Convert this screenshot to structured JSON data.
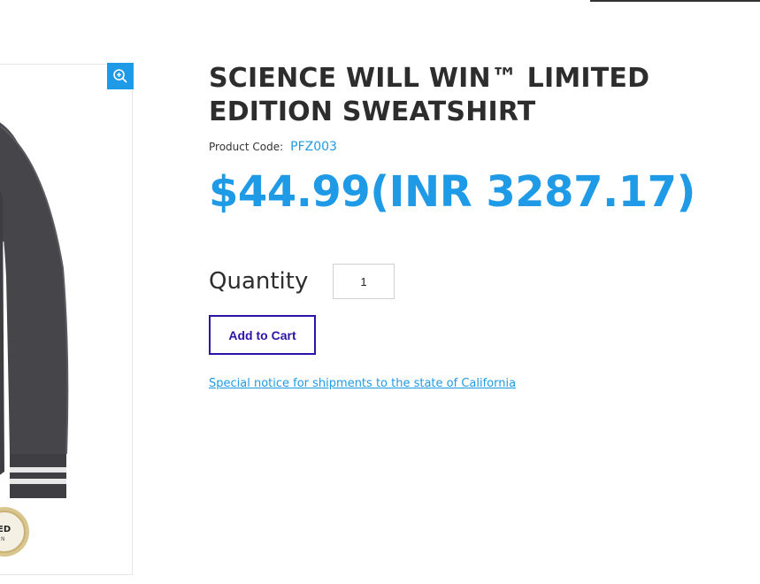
{
  "product": {
    "title": "SCIENCE WILL WIN™ LIMITED EDITION SWEATSHIRT",
    "code_label": "Product Code:",
    "code_value": "PFZ003",
    "price": "$44.99(INR 3287.17)"
  },
  "quantity": {
    "label": "Quantity",
    "value": "1"
  },
  "actions": {
    "add_to_cart": "Add to Cart",
    "california_notice": "Special notice for shipments to the state of California"
  },
  "image_badge_text": "ED N",
  "icons": {
    "zoom": "zoom-in-icon"
  },
  "colors": {
    "accent_blue": "#1f9ae6",
    "button_purple": "#2e14a6",
    "title_text": "#2d2d2d"
  }
}
